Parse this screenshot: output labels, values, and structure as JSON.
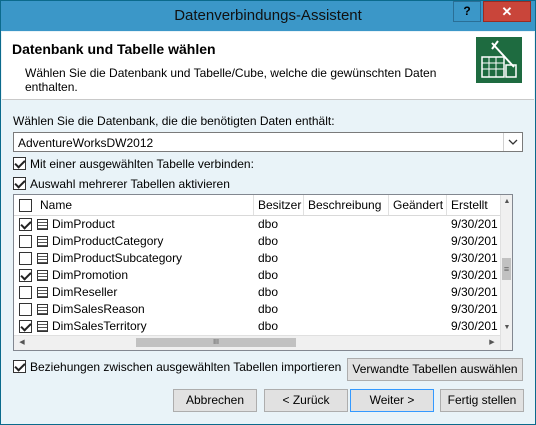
{
  "window": {
    "title": "Datenverbindungs-Assistent",
    "help_label": "?",
    "close_label": "✕"
  },
  "header": {
    "title": "Datenbank und Tabelle wählen",
    "description": "Wählen Sie die Datenbank und Tabelle/Cube, welche die gewünschten Daten enthalten.",
    "icon": "database-wizard-icon"
  },
  "database": {
    "label": "Wählen Sie die Datenbank, die die benötigten Daten enthält:",
    "selected": "AdventureWorksDW2012"
  },
  "options": {
    "connect_table": {
      "label": "Mit einer ausgewählten Tabelle verbinden:",
      "checked": true
    },
    "multi_select": {
      "label": "Auswahl mehrerer Tabellen aktivieren",
      "checked": true
    }
  },
  "table": {
    "columns": [
      "Name",
      "Besitzer",
      "Beschreibung",
      "Geändert",
      "Erstellt"
    ],
    "rows": [
      {
        "name": "DimProduct",
        "owner": "dbo",
        "created": "9/30/201",
        "checked": true
      },
      {
        "name": "DimProductCategory",
        "owner": "dbo",
        "created": "9/30/201",
        "checked": false
      },
      {
        "name": "DimProductSubcategory",
        "owner": "dbo",
        "created": "9/30/201",
        "checked": false
      },
      {
        "name": "DimPromotion",
        "owner": "dbo",
        "created": "9/30/201",
        "checked": true
      },
      {
        "name": "DimReseller",
        "owner": "dbo",
        "created": "9/30/201",
        "checked": false
      },
      {
        "name": "DimSalesReason",
        "owner": "dbo",
        "created": "9/30/201",
        "checked": false
      },
      {
        "name": "DimSalesTerritory",
        "owner": "dbo",
        "created": "9/30/201",
        "checked": true
      }
    ],
    "hscroll_grip": "III",
    "vscroll_grip": "≡"
  },
  "relations": {
    "label": "Beziehungen zwischen ausgewählten Tabellen importieren",
    "checked": true
  },
  "buttons": {
    "related": "Verwandte Tabellen auswählen",
    "cancel": "Abbrechen",
    "back": "< Zurück",
    "next": "Weiter >",
    "finish": "Fertig stellen"
  },
  "colors": {
    "titlebar": "#3b97c8",
    "close": "#c9453a",
    "dialog_bg": "#e9f3f8",
    "accent_border": "#3399ff"
  }
}
